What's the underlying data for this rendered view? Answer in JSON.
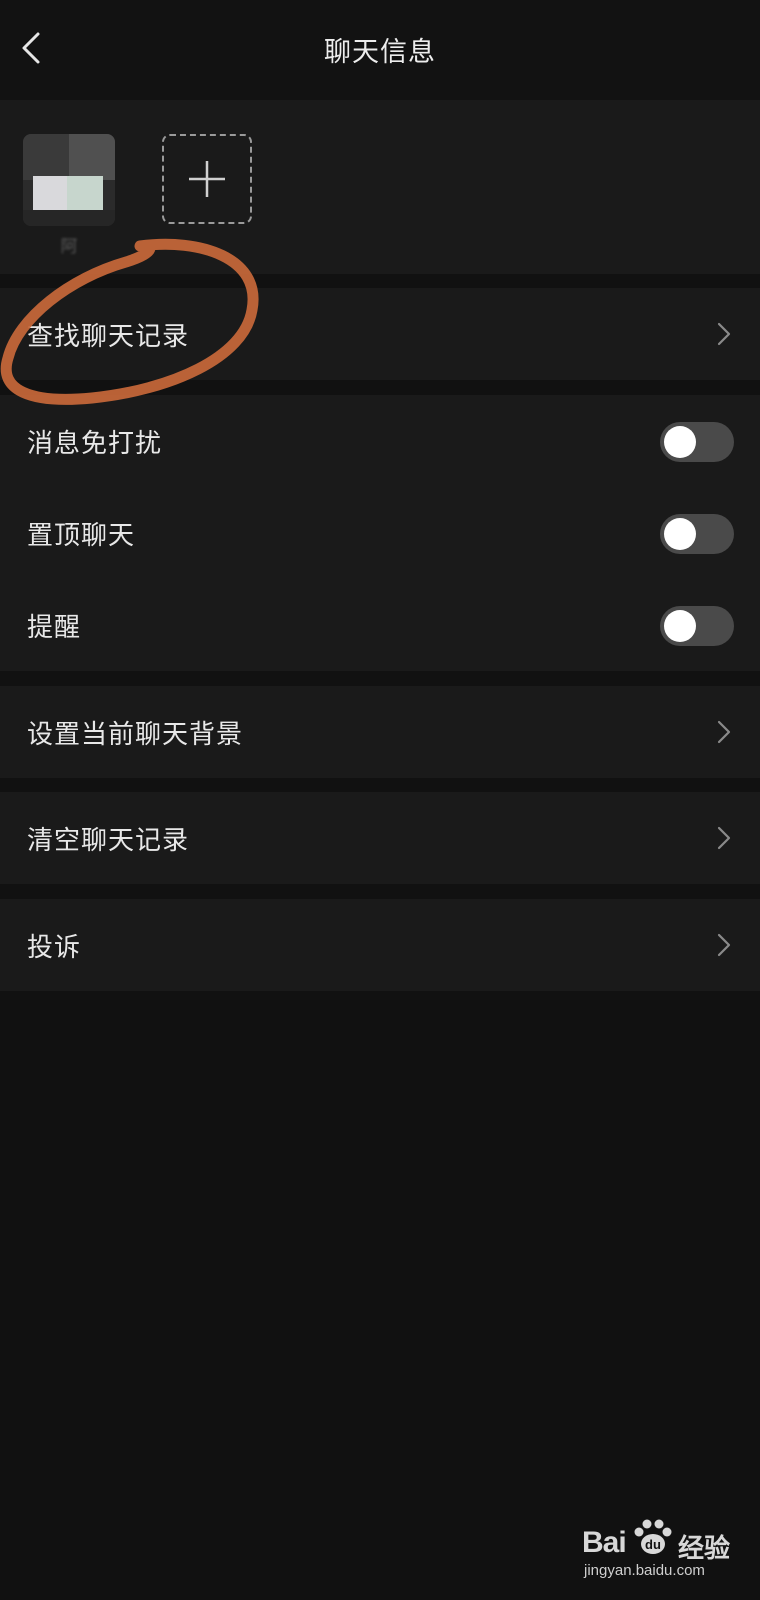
{
  "header": {
    "title": "聊天信息"
  },
  "members": {
    "first_member_name": "阿",
    "add_button": "+"
  },
  "rows": {
    "search_history": "查找聊天记录",
    "mute_notifications": "消息免打扰",
    "pin_chat": "置顶聊天",
    "remind": "提醒",
    "set_background": "设置当前聊天背景",
    "clear_history": "清空聊天记录",
    "complain": "投诉"
  },
  "toggles": {
    "mute_notifications": false,
    "pin_chat": false,
    "remind": false
  },
  "watermark": {
    "brand_left": "Bai",
    "brand_right": "du",
    "jingyan": "经验",
    "url": "jingyan.baidu.com"
  },
  "colors": {
    "background": "#111111",
    "panel": "#1a1a1a",
    "annotation": "#c8683a",
    "toggle_off": "#4a4a4a"
  }
}
